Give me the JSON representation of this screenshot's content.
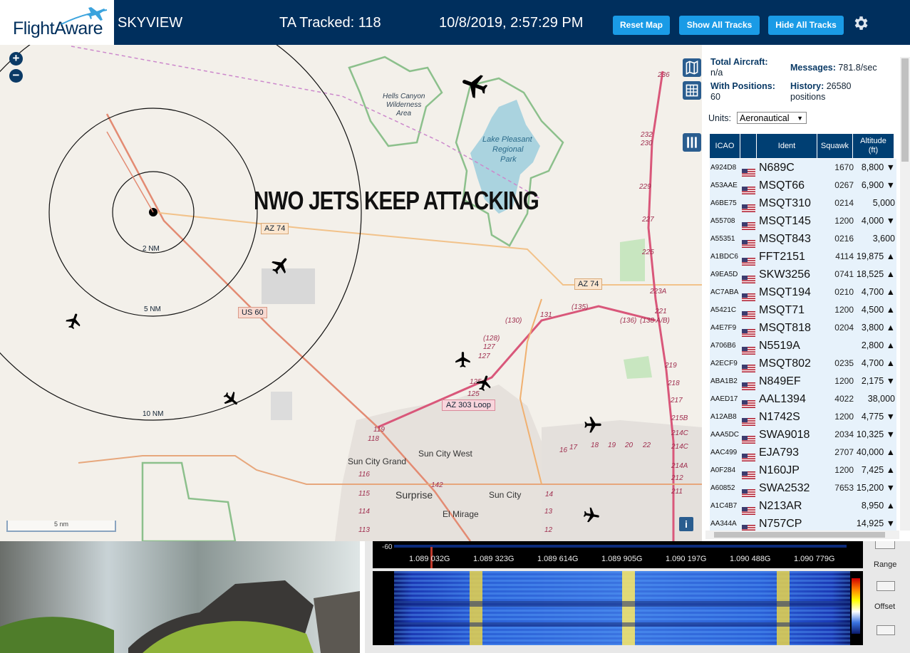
{
  "header": {
    "logo_text": "FlightAware",
    "app_name": "SKYVIEW",
    "tracked": "TA Tracked: 118",
    "datetime": "10/8/2019, 2:57:29 PM",
    "reset_map": "Reset Map",
    "show_tracks": "Show All Tracks",
    "hide_tracks": "Hide All Tracks",
    "settings_icon": "gear-icon"
  },
  "map": {
    "overlay_text": "NWO JETS KEEP ATTACKING",
    "ring_labels": [
      "2 NM",
      "5 NM",
      "10 NM"
    ],
    "places": [
      "Hells Canyon",
      "Wilderness",
      "Area",
      "Lake Pleasant",
      "Regional",
      "Park",
      "Sun City West",
      "Sun City Grand",
      "Surprise",
      "Sun City",
      "El Mirage"
    ],
    "road_shields": [
      "AZ 74",
      "AZ 74",
      "US 60",
      "AZ 303 Loop"
    ],
    "route_numbers": [
      "236",
      "232",
      "230",
      "229",
      "227",
      "225",
      "223A",
      "221",
      "219",
      "218",
      "217",
      "215B",
      "214C",
      "214C",
      "214A",
      "212",
      "211",
      "(130)",
      "131",
      "(135)",
      "(136)",
      "(138 A/B)",
      "(128)",
      "127",
      "127",
      "125",
      "125",
      "119",
      "118",
      "116",
      "115",
      "114",
      "113",
      "142",
      "17",
      "16",
      "18",
      "19",
      "20",
      "22",
      "14",
      "13",
      "12"
    ],
    "scale_label": "5 nm",
    "zoom_in": "+",
    "zoom_out": "−",
    "info_label": "i"
  },
  "stats": {
    "total_aircraft_label": "Total Aircraft:",
    "total_aircraft_value": "n/a",
    "with_positions_label": "With Positions:",
    "with_positions_value": "60",
    "messages_label": "Messages:",
    "messages_value": "781.8/sec",
    "history_label": "History:",
    "history_value": "26580",
    "history_unit": "positions",
    "units_label": "Units:",
    "units_value": "Aeronautical"
  },
  "table": {
    "headers": [
      "ICAO",
      "",
      "Ident",
      "Squawk",
      "Altitude",
      "(ft)"
    ],
    "rows": [
      {
        "icao": "A924D8",
        "ident": "N689C",
        "squawk": "1670",
        "alt": "8,800 ▼"
      },
      {
        "icao": "A53AAE",
        "ident": "MSQT66",
        "squawk": "0267",
        "alt": "6,900 ▼"
      },
      {
        "icao": "A6BE75",
        "ident": "MSQT310",
        "squawk": "0214",
        "alt": "5,000"
      },
      {
        "icao": "A55708",
        "ident": "MSQT145",
        "squawk": "1200",
        "alt": "4,000 ▼"
      },
      {
        "icao": "A55351",
        "ident": "MSQT843",
        "squawk": "0216",
        "alt": "3,600"
      },
      {
        "icao": "A1BDC6",
        "ident": "FFT2151",
        "squawk": "4114",
        "alt": "19,875 ▲"
      },
      {
        "icao": "A9EA5D",
        "ident": "SKW3256",
        "squawk": "0741",
        "alt": "18,525 ▲"
      },
      {
        "icao": "AC7ABA",
        "ident": "MSQT194",
        "squawk": "0210",
        "alt": "4,700 ▲"
      },
      {
        "icao": "A5421C",
        "ident": "MSQT71",
        "squawk": "1200",
        "alt": "4,500 ▲"
      },
      {
        "icao": "A4E7F9",
        "ident": "MSQT818",
        "squawk": "0204",
        "alt": "3,800 ▲"
      },
      {
        "icao": "A706B6",
        "ident": "N5519A",
        "squawk": "",
        "alt": "2,800 ▲"
      },
      {
        "icao": "A2ECF9",
        "ident": "MSQT802",
        "squawk": "0235",
        "alt": "4,700 ▲"
      },
      {
        "icao": "ABA1B2",
        "ident": "N849EF",
        "squawk": "1200",
        "alt": "2,175 ▼"
      },
      {
        "icao": "AAED17",
        "ident": "AAL1394",
        "squawk": "4022",
        "alt": "38,000"
      },
      {
        "icao": "A12AB8",
        "ident": "N1742S",
        "squawk": "1200",
        "alt": "4,775 ▼"
      },
      {
        "icao": "AAA5DC",
        "ident": "SWA9018",
        "squawk": "2034",
        "alt": "10,325 ▼"
      },
      {
        "icao": "AAC499",
        "ident": "EJA793",
        "squawk": "2707",
        "alt": "40,000 ▲"
      },
      {
        "icao": "A0F284",
        "ident": "N160JP",
        "squawk": "1200",
        "alt": "7,425 ▲"
      },
      {
        "icao": "A60852",
        "ident": "SWA2532",
        "squawk": "7653",
        "alt": "15,200 ▼"
      },
      {
        "icao": "A1C4B7",
        "ident": "N213AR",
        "squawk": "",
        "alt": "8,950 ▲"
      },
      {
        "icao": "AA344A",
        "ident": "N757CP",
        "squawk": "",
        "alt": "14,925 ▼"
      }
    ]
  },
  "spectrum": {
    "db_label": "-60",
    "freqs": [
      "1.089 032G",
      "1.089 323G",
      "1.089 614G",
      "1.089 905G",
      "1.090 197G",
      "1.090 488G",
      "1.090 779G"
    ],
    "range_label": "Range",
    "offset_label": "Offset"
  },
  "colors": {
    "header_bg": "#002f5d",
    "button_bg": "#1a9be6",
    "table_header_bg": "#003f73",
    "row_bg": "#e7f2fb",
    "road_red": "#d94a6a",
    "highway": "#e8a070"
  }
}
